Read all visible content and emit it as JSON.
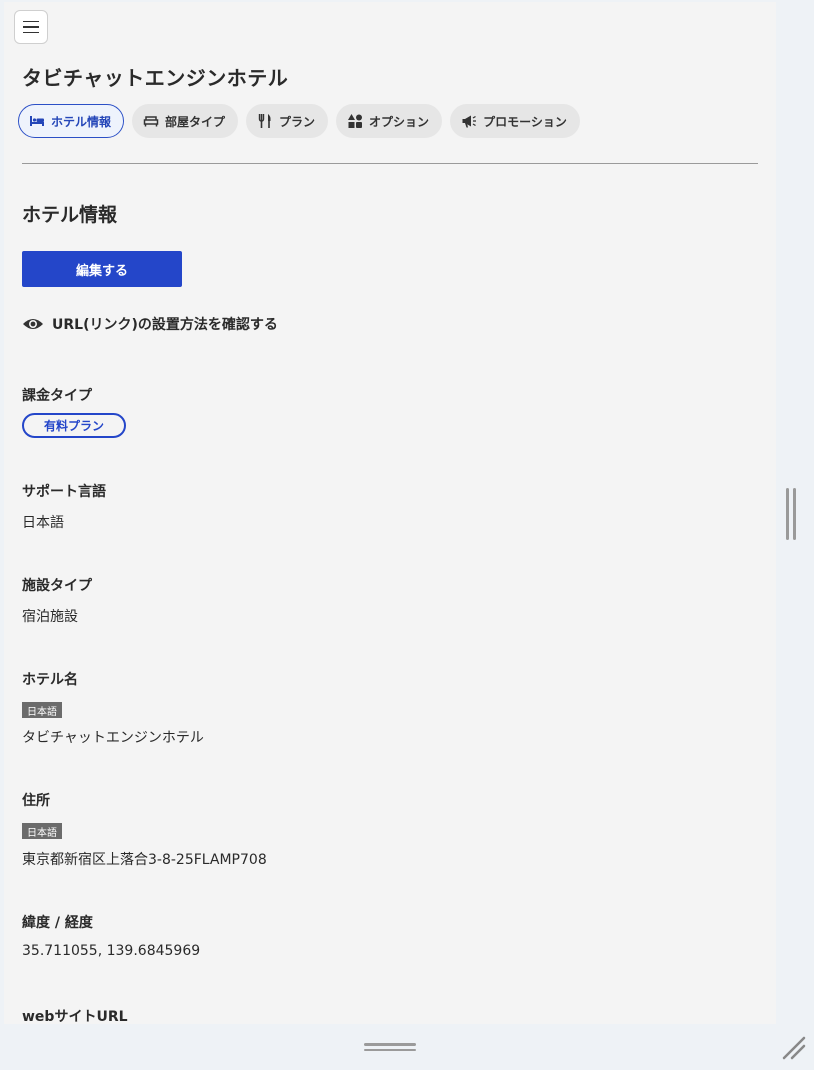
{
  "header": {
    "hotel_title": "タビチャットエンジンホテル"
  },
  "tabs": [
    {
      "label": "ホテル情報",
      "icon": "bed-icon",
      "active": true
    },
    {
      "label": "部屋タイプ",
      "icon": "room-bed-icon",
      "active": false
    },
    {
      "label": "プラン",
      "icon": "cutlery-icon",
      "active": false
    },
    {
      "label": "オプション",
      "icon": "shapes-icon",
      "active": false
    },
    {
      "label": "プロモーション",
      "icon": "megaphone-icon",
      "active": false
    }
  ],
  "section": {
    "title": "ホテル情報",
    "edit_label": "編集する",
    "url_link_label": "URL(リンク)の設置方法を確認する"
  },
  "fields": {
    "billing_type": {
      "label": "課金タイプ",
      "badge": "有料プラン"
    },
    "support_language": {
      "label": "サポート言語",
      "value": "日本語"
    },
    "facility_type": {
      "label": "施設タイプ",
      "value": "宿泊施設"
    },
    "hotel_name": {
      "label": "ホテル名",
      "lang": "日本語",
      "value": "タビチャットエンジンホテル"
    },
    "address": {
      "label": "住所",
      "lang": "日本語",
      "value": "東京都新宿区上落合3-8-25FLAMP708"
    },
    "latlng": {
      "label": "緯度 / 経度",
      "value": "35.711055, 139.6845969"
    },
    "website": {
      "label": "webサイトURL"
    }
  },
  "colors": {
    "accent": "#2446c9",
    "panel_bg": "#f4f4f4",
    "lang_tag_bg": "#6b6b6b"
  }
}
